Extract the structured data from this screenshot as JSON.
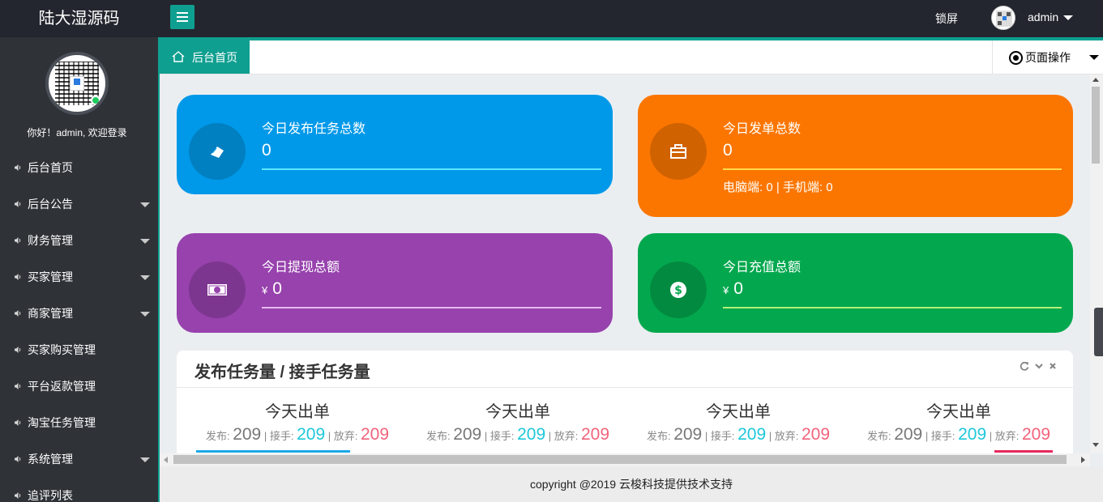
{
  "header": {
    "logo": "陆大湿源码",
    "lock_label": "锁屏",
    "username": "admin"
  },
  "sidebar": {
    "welcome": "你好！admin, 欢迎登录",
    "items": [
      {
        "label": "后台首页",
        "has_submenu": false
      },
      {
        "label": "后台公告",
        "has_submenu": true
      },
      {
        "label": "财务管理",
        "has_submenu": true
      },
      {
        "label": "买家管理",
        "has_submenu": true
      },
      {
        "label": "商家管理",
        "has_submenu": true
      },
      {
        "label": "买家购买管理",
        "has_submenu": false
      },
      {
        "label": "平台返款管理",
        "has_submenu": false
      },
      {
        "label": "淘宝任务管理",
        "has_submenu": false
      },
      {
        "label": "系统管理",
        "has_submenu": true
      },
      {
        "label": "追评列表",
        "has_submenu": false
      }
    ]
  },
  "tabs": {
    "home": "后台首页",
    "page_ops": "页面操作"
  },
  "cards": [
    {
      "title": "今日发布任务总数",
      "value": "0",
      "currency": "",
      "extra": "",
      "color": "#0099e9",
      "line_color": "#5ee8ff",
      "icon": "ticket-icon"
    },
    {
      "title": "今日发单总数",
      "value": "0",
      "currency": "",
      "extra": "电脑端: 0 | 手机端: 0",
      "color": "#fb7601",
      "line_color": "#ffd84a",
      "icon": "briefcase-icon"
    },
    {
      "title": "今日提现总额",
      "value": "0",
      "currency": "¥",
      "extra": "",
      "color": "#9742ad",
      "line_color": "#e8b8f0",
      "icon": "banknote-icon"
    },
    {
      "title": "今日充值总额",
      "value": "0",
      "currency": "¥",
      "extra": "",
      "color": "#03a84e",
      "line_color": "#b6f07a",
      "icon": "dollar-circle-icon"
    }
  ],
  "panel": {
    "title": "发布任务量 / 接手任务量",
    "stats": [
      {
        "title": "今天出单",
        "pub_label": "发布:",
        "pub": "209",
        "take_label": "接手:",
        "take": "209",
        "give_label": "放弃:",
        "give": "209"
      },
      {
        "title": "今天出单",
        "pub_label": "发布:",
        "pub": "209",
        "take_label": "接手:",
        "take": "209",
        "give_label": "放弃:",
        "give": "209"
      },
      {
        "title": "今天出单",
        "pub_label": "发布:",
        "pub": "209",
        "take_label": "接手:",
        "take": "209",
        "give_label": "放弃:",
        "give": "209"
      },
      {
        "title": "今天出单",
        "pub_label": "发布:",
        "pub": "209",
        "take_label": "接手:",
        "take": "209",
        "give_label": "放弃:",
        "give": "209"
      }
    ]
  },
  "footer": "copyright @2019 云梭科技提供技术支持"
}
